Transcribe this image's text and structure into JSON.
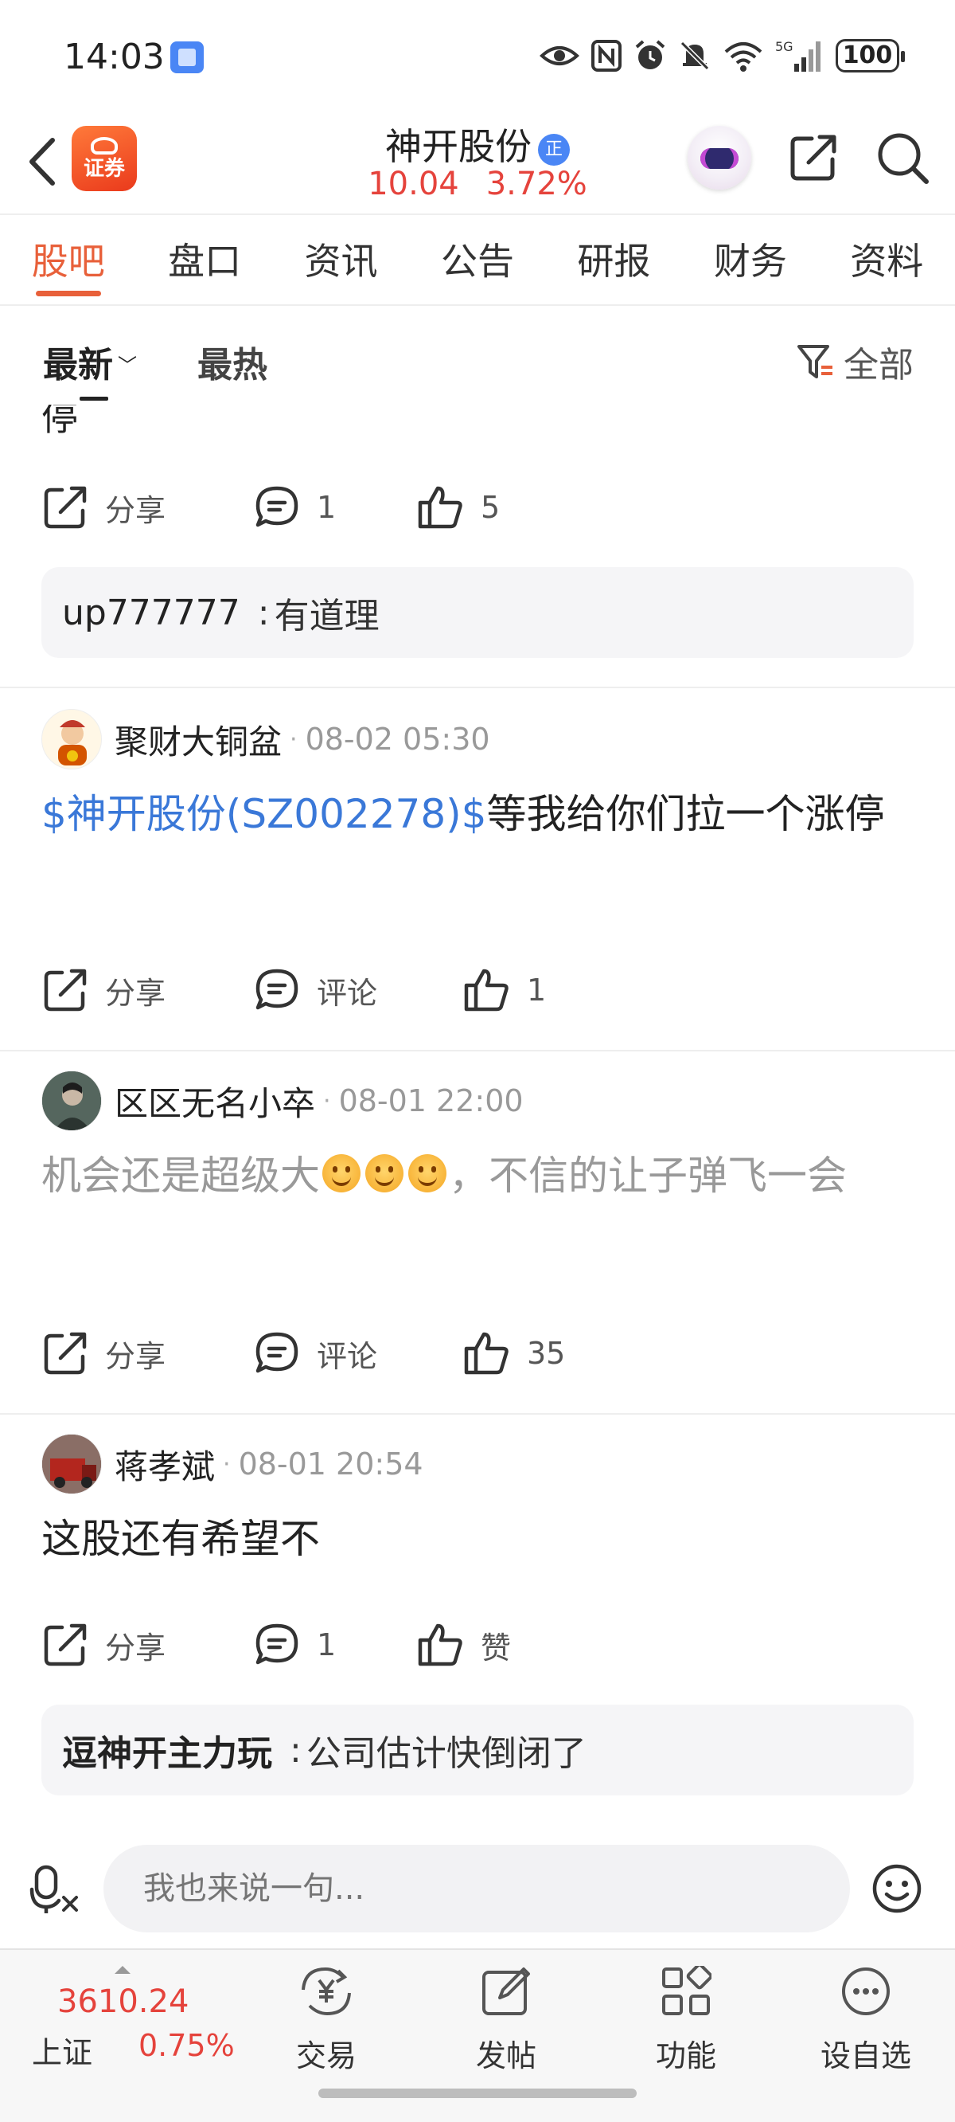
{
  "status_bar": {
    "time": "14:03",
    "battery": "100",
    "network": "5G"
  },
  "header": {
    "stock_name": "神开股份",
    "badge": "正",
    "price": "10.04",
    "change_percent": "3.72%",
    "logo_text": "证券",
    "accent_color": "#e8603a",
    "up_color": "#e5433c"
  },
  "tabs": [
    {
      "label": "股吧",
      "active": true
    },
    {
      "label": "盘口",
      "active": false
    },
    {
      "label": "资讯",
      "active": false
    },
    {
      "label": "公告",
      "active": false
    },
    {
      "label": "研报",
      "active": false
    },
    {
      "label": "财务",
      "active": false
    },
    {
      "label": "资料",
      "active": false
    }
  ],
  "sort_bar": {
    "latest": "最新",
    "hot": "最热",
    "filter": "全部"
  },
  "feed": {
    "cutoff_text": "停",
    "posts": [
      {
        "share_label": "分享",
        "comment_label": "1",
        "like_label": "5",
        "reply": {
          "user": "up777777",
          "text": "有道理"
        }
      },
      {
        "author": "聚财大铜盆",
        "time": "08-02 05:30",
        "stock_link": "$神开股份(SZ002278)$",
        "text": "等我给你们拉一个涨停",
        "share_label": "分享",
        "comment_label": "评论",
        "like_label": "1"
      },
      {
        "author": "区区无名小卒",
        "time": "08-01 22:00",
        "text_before": "机会还是超级大",
        "text_after": "，不信的让子弹飞一会",
        "share_label": "分享",
        "comment_label": "评论",
        "like_label": "35"
      },
      {
        "author": "蒋孝斌",
        "time": "08-01 20:54",
        "text": "这股还有希望不",
        "share_label": "分享",
        "comment_label": "1",
        "like_label": "赞",
        "reply": {
          "user": "逗神开主力玩",
          "text": "公司估计快倒闭了"
        }
      }
    ]
  },
  "comment_input": {
    "placeholder": "我也来说一句..."
  },
  "bottom_nav": {
    "index_value": "3610.24",
    "index_name": "上证",
    "index_change": "0.75%",
    "items": [
      {
        "label": "交易"
      },
      {
        "label": "发帖"
      },
      {
        "label": "功能"
      },
      {
        "label": "设自选"
      }
    ]
  }
}
